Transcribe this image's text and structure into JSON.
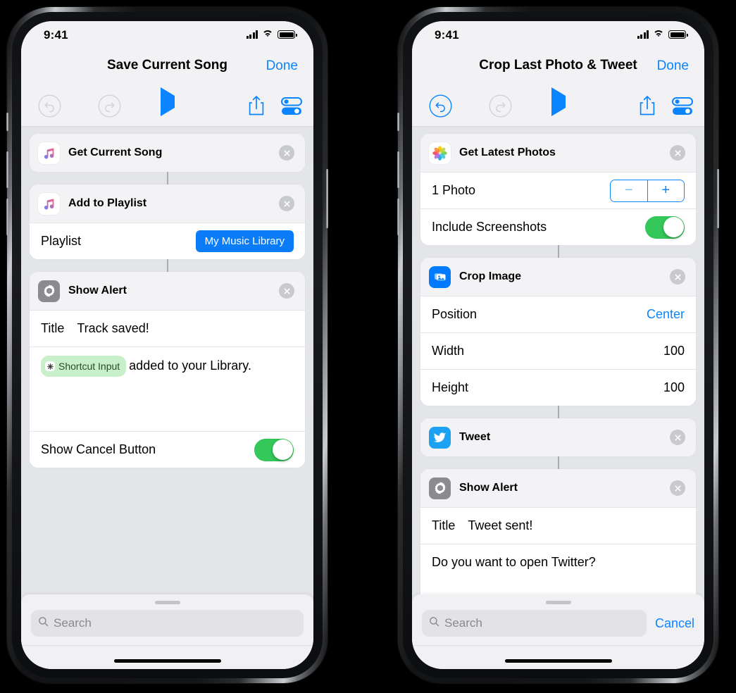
{
  "phones": [
    {
      "id": "left",
      "status": {
        "time": "9:41",
        "cellular": "signal-bars-icon",
        "wifi": "wifi-icon",
        "battery": "battery-icon"
      },
      "nav": {
        "title": "Save Current Song",
        "done_label": "Done"
      },
      "toolbar": {
        "undo": "undo-icon",
        "undo_enabled": false,
        "redo": "redo-icon",
        "redo_enabled": false,
        "play": "play-icon",
        "share": "share-icon",
        "settings": "settings-toggles-icon"
      },
      "actions": [
        {
          "icon": "music-note-icon",
          "title": "Get Current Song",
          "remove": "remove-icon",
          "rows": []
        },
        {
          "icon": "music-note-icon",
          "title": "Add to Playlist",
          "remove": "remove-icon",
          "rows": [
            {
              "type": "pill",
              "label": "Playlist",
              "value": "My Music Library"
            }
          ]
        },
        {
          "icon": "gear-icon",
          "title": "Show Alert",
          "remove": "remove-icon",
          "rows": [
            {
              "type": "title",
              "label": "Title",
              "value": "Track saved!"
            },
            {
              "type": "body",
              "token": "Shortcut Input",
              "text": "added to your Library."
            },
            {
              "type": "switch",
              "label": "Show Cancel Button",
              "on": true
            }
          ]
        }
      ],
      "bottom": {
        "grabber": "grabber-handle",
        "search_icon": "search-icon",
        "search_placeholder": "Search",
        "search_value": "",
        "cancel_label": ""
      }
    },
    {
      "id": "right",
      "status": {
        "time": "9:41",
        "cellular": "signal-bars-icon",
        "wifi": "wifi-icon",
        "battery": "battery-icon"
      },
      "nav": {
        "title": "Crop Last Photo & Tweet",
        "done_label": "Done"
      },
      "toolbar": {
        "undo": "undo-icon",
        "undo_enabled": true,
        "redo": "redo-icon",
        "redo_enabled": false,
        "play": "play-icon",
        "share": "share-icon",
        "settings": "settings-toggles-icon"
      },
      "actions": [
        {
          "icon": "photos-icon",
          "title": "Get Latest Photos",
          "remove": "remove-icon",
          "rows": [
            {
              "type": "stepper",
              "label": "1 Photo",
              "minus": "−",
              "plus": "+"
            },
            {
              "type": "switch",
              "label": "Include Screenshots",
              "on": true
            }
          ]
        },
        {
          "icon": "crop-image-icon",
          "title": "Crop Image",
          "remove": "remove-icon",
          "rows": [
            {
              "type": "value",
              "label": "Position",
              "value": "Center",
              "accent": true
            },
            {
              "type": "value",
              "label": "Width",
              "value": "100",
              "accent": false
            },
            {
              "type": "value",
              "label": "Height",
              "value": "100",
              "accent": false
            }
          ]
        },
        {
          "icon": "twitter-icon",
          "title": "Tweet",
          "remove": "remove-icon",
          "rows": []
        },
        {
          "icon": "gear-icon",
          "title": "Show Alert",
          "remove": "remove-icon",
          "rows": [
            {
              "type": "title",
              "label": "Title",
              "value": "Tweet sent!"
            },
            {
              "type": "body",
              "token": "",
              "text": "Do you want to open Twitter?"
            }
          ]
        }
      ],
      "bottom": {
        "grabber": "grabber-handle",
        "search_icon": "search-icon",
        "search_placeholder": "Search",
        "search_value": "",
        "cancel_label": "Cancel"
      }
    }
  ],
  "colors": {
    "accent_blue": "#0b84ff",
    "pill_blue": "#0b7cf7",
    "switch_green": "#34C759",
    "token_green": "#C7EFC9",
    "background_gray": "#E3E5E9",
    "card_header_gray": "#F3F3F5"
  }
}
